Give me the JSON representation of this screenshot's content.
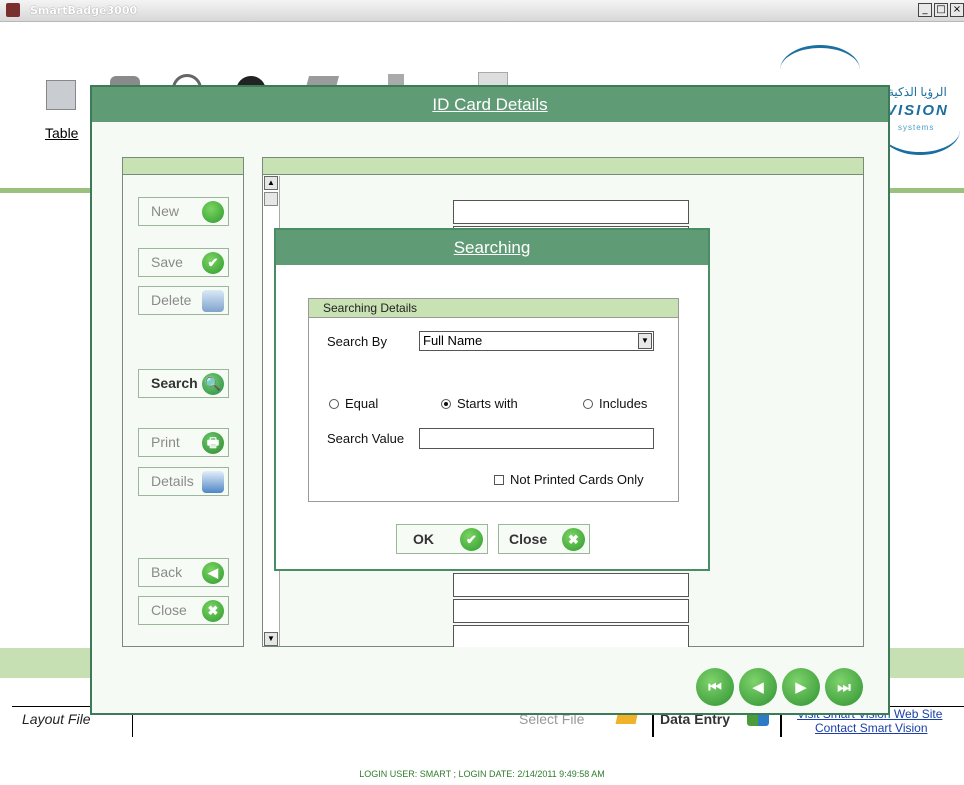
{
  "app": {
    "title": "SmartBadge3000",
    "window_buttons": [
      "_",
      "□",
      "×"
    ]
  },
  "toolbar": {
    "table_link": "Table"
  },
  "logo": {
    "arabic": "الرؤيا الذكية",
    "vision": "VISION",
    "systems": "systems"
  },
  "card_dialog": {
    "title": "ID Card Details",
    "side_buttons": {
      "new": "New",
      "save": "Save",
      "delete": "Delete",
      "search": "Search",
      "print": "Print",
      "details": "Details",
      "back": "Back",
      "close": "Close"
    },
    "icons": {
      "save": "✔",
      "search": "🔍",
      "print": "🖶",
      "back": "◀",
      "close": "✖"
    },
    "nav": {
      "first": "⏮",
      "prev": "◀",
      "next": "▶",
      "last": "⏭"
    }
  },
  "search_dialog": {
    "title": "Searching",
    "group_title": "Searching Details",
    "search_by_label": "Search By",
    "search_by_value": "Full Name",
    "dropdown_arrow": "▼",
    "radio_equal": "Equal",
    "radio_starts_with": "Starts with",
    "radio_includes": "Includes",
    "search_value_label": "Search Value",
    "search_value": "",
    "checkbox_label": "Not Printed Cards Only",
    "ok": "OK",
    "ok_icon": "✔",
    "close": "Close",
    "close_icon": "✖"
  },
  "bottom_bar": {
    "layout_file": "Layout File",
    "select_file": "Select File",
    "data_entry": "Data Entry",
    "web_site_link": "Visit Smart Vision Web Site",
    "contact_link": "Contact Smart Vision"
  },
  "status": {
    "login": "LOGIN USER: SMART ; LOGIN DATE: 2/14/2011 9:49:58 AM"
  }
}
